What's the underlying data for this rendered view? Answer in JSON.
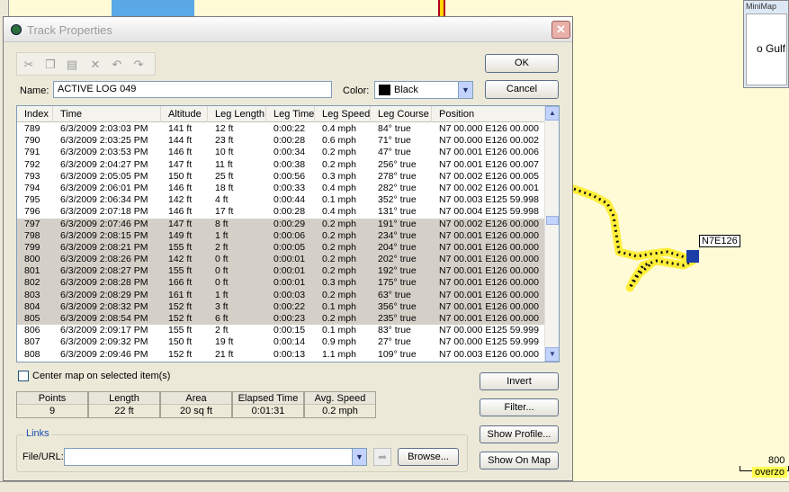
{
  "dialog": {
    "title": "Track Properties",
    "close_glyph": "✕",
    "ok_label": "OK",
    "cancel_label": "Cancel"
  },
  "toolbar": {
    "icons": [
      "cut-icon",
      "copy-icon",
      "paste-icon",
      "delete-icon",
      "undo-icon",
      "redo-icon"
    ]
  },
  "form": {
    "name_label": "Name:",
    "name_value": "ACTIVE LOG 049",
    "color_label": "Color:",
    "color_value": "Black",
    "color_swatch": "#000000"
  },
  "table": {
    "columns": [
      "Index",
      "Time",
      "Altitude",
      "Leg Length",
      "Leg Time",
      "Leg Speed",
      "Leg Course",
      "Position"
    ],
    "rows": [
      {
        "cells": [
          "789",
          "6/3/2009 2:03:03 PM",
          "141 ft",
          "12 ft",
          "0:00:22",
          "0.4 mph",
          "84° true",
          "N7 00.000 E126 00.000"
        ],
        "selected": false
      },
      {
        "cells": [
          "790",
          "6/3/2009 2:03:25 PM",
          "144 ft",
          "23 ft",
          "0:00:28",
          "0.6 mph",
          "71° true",
          "N7 00.000 E126 00.002"
        ],
        "selected": false
      },
      {
        "cells": [
          "791",
          "6/3/2009 2:03:53 PM",
          "146 ft",
          "10 ft",
          "0:00:34",
          "0.2 mph",
          "47° true",
          "N7 00.001 E126 00.006"
        ],
        "selected": false
      },
      {
        "cells": [
          "792",
          "6/3/2009 2:04:27 PM",
          "147 ft",
          "11 ft",
          "0:00:38",
          "0.2 mph",
          "256° true",
          "N7 00.001 E126 00.007"
        ],
        "selected": false
      },
      {
        "cells": [
          "793",
          "6/3/2009 2:05:05 PM",
          "150 ft",
          "25 ft",
          "0:00:56",
          "0.3 mph",
          "278° true",
          "N7 00.002 E126 00.005"
        ],
        "selected": false
      },
      {
        "cells": [
          "794",
          "6/3/2009 2:06:01 PM",
          "146 ft",
          "18 ft",
          "0:00:33",
          "0.4 mph",
          "282° true",
          "N7 00.002 E126 00.001"
        ],
        "selected": false
      },
      {
        "cells": [
          "795",
          "6/3/2009 2:06:34 PM",
          "142 ft",
          "4 ft",
          "0:00:44",
          "0.1 mph",
          "352° true",
          "N7 00.003 E125 59.998"
        ],
        "selected": false
      },
      {
        "cells": [
          "796",
          "6/3/2009 2:07:18 PM",
          "146 ft",
          "17 ft",
          "0:00:28",
          "0.4 mph",
          "131° true",
          "N7 00.004 E125 59.998"
        ],
        "selected": false
      },
      {
        "cells": [
          "797",
          "6/3/2009 2:07:46 PM",
          "147 ft",
          "8 ft",
          "0:00:29",
          "0.2 mph",
          "191° true",
          "N7 00.002 E126 00.000"
        ],
        "selected": true
      },
      {
        "cells": [
          "798",
          "6/3/2009 2:08:15 PM",
          "149 ft",
          "1 ft",
          "0:00:06",
          "0.2 mph",
          "234° true",
          "N7 00.001 E126 00.000"
        ],
        "selected": true
      },
      {
        "cells": [
          "799",
          "6/3/2009 2:08:21 PM",
          "155 ft",
          "2 ft",
          "0:00:05",
          "0.2 mph",
          "204° true",
          "N7 00.001 E126 00.000"
        ],
        "selected": true
      },
      {
        "cells": [
          "800",
          "6/3/2009 2:08:26 PM",
          "142 ft",
          "0 ft",
          "0:00:01",
          "0.2 mph",
          "202° true",
          "N7 00.001 E126 00.000"
        ],
        "selected": true
      },
      {
        "cells": [
          "801",
          "6/3/2009 2:08:27 PM",
          "155 ft",
          "0 ft",
          "0:00:01",
          "0.2 mph",
          "192° true",
          "N7 00.001 E126 00.000"
        ],
        "selected": true
      },
      {
        "cells": [
          "802",
          "6/3/2009 2:08:28 PM",
          "166 ft",
          "0 ft",
          "0:00:01",
          "0.3 mph",
          "175° true",
          "N7 00.001 E126 00.000"
        ],
        "selected": true
      },
      {
        "cells": [
          "803",
          "6/3/2009 2:08:29 PM",
          "161 ft",
          "1 ft",
          "0:00:03",
          "0.2 mph",
          "63° true",
          "N7 00.001 E126 00.000"
        ],
        "selected": true
      },
      {
        "cells": [
          "804",
          "6/3/2009 2:08:32 PM",
          "152 ft",
          "3 ft",
          "0:00:22",
          "0.1 mph",
          "356° true",
          "N7 00.001 E126 00.000"
        ],
        "selected": true
      },
      {
        "cells": [
          "805",
          "6/3/2009 2:08:54 PM",
          "152 ft",
          "6 ft",
          "0:00:23",
          "0.2 mph",
          "235° true",
          "N7 00.001 E126 00.000"
        ],
        "selected": true
      },
      {
        "cells": [
          "806",
          "6/3/2009 2:09:17 PM",
          "155 ft",
          "2 ft",
          "0:00:15",
          "0.1 mph",
          "83° true",
          "N7 00.000 E125 59.999"
        ],
        "selected": false
      },
      {
        "cells": [
          "807",
          "6/3/2009 2:09:32 PM",
          "150 ft",
          "19 ft",
          "0:00:14",
          "0.9 mph",
          "27° true",
          "N7 00.000 E125 59.999"
        ],
        "selected": false
      },
      {
        "cells": [
          "808",
          "6/3/2009 2:09:46 PM",
          "152 ft",
          "21 ft",
          "0:00:13",
          "1.1 mph",
          "109° true",
          "N7 00.003 E126 00.000"
        ],
        "selected": false
      }
    ]
  },
  "center_map": {
    "label": "Center map on selected item(s)",
    "checked": false
  },
  "stats": {
    "points_label": "Points",
    "points_value": "9",
    "length_label": "Length",
    "length_value": "22 ft",
    "area_label": "Area",
    "area_value": "20 sq ft",
    "elapsed_label": "Elapsed Time",
    "elapsed_value": "0:01:31",
    "speed_label": "Avg. Speed",
    "speed_value": "0.2 mph"
  },
  "side_buttons": {
    "invert": "Invert",
    "filter": "Filter...",
    "show_profile": "Show Profile...",
    "show_on_map": "Show On Map"
  },
  "links": {
    "group_label": "Links",
    "file_label": "File/URL:",
    "file_value": "",
    "browse_label": "Browse..."
  },
  "map": {
    "minimap_title": "MiniMap",
    "minimap_text": "o Gulf",
    "waypoint_label": "N7E126",
    "scale_value": "800",
    "overzoom_text": "overzo"
  }
}
